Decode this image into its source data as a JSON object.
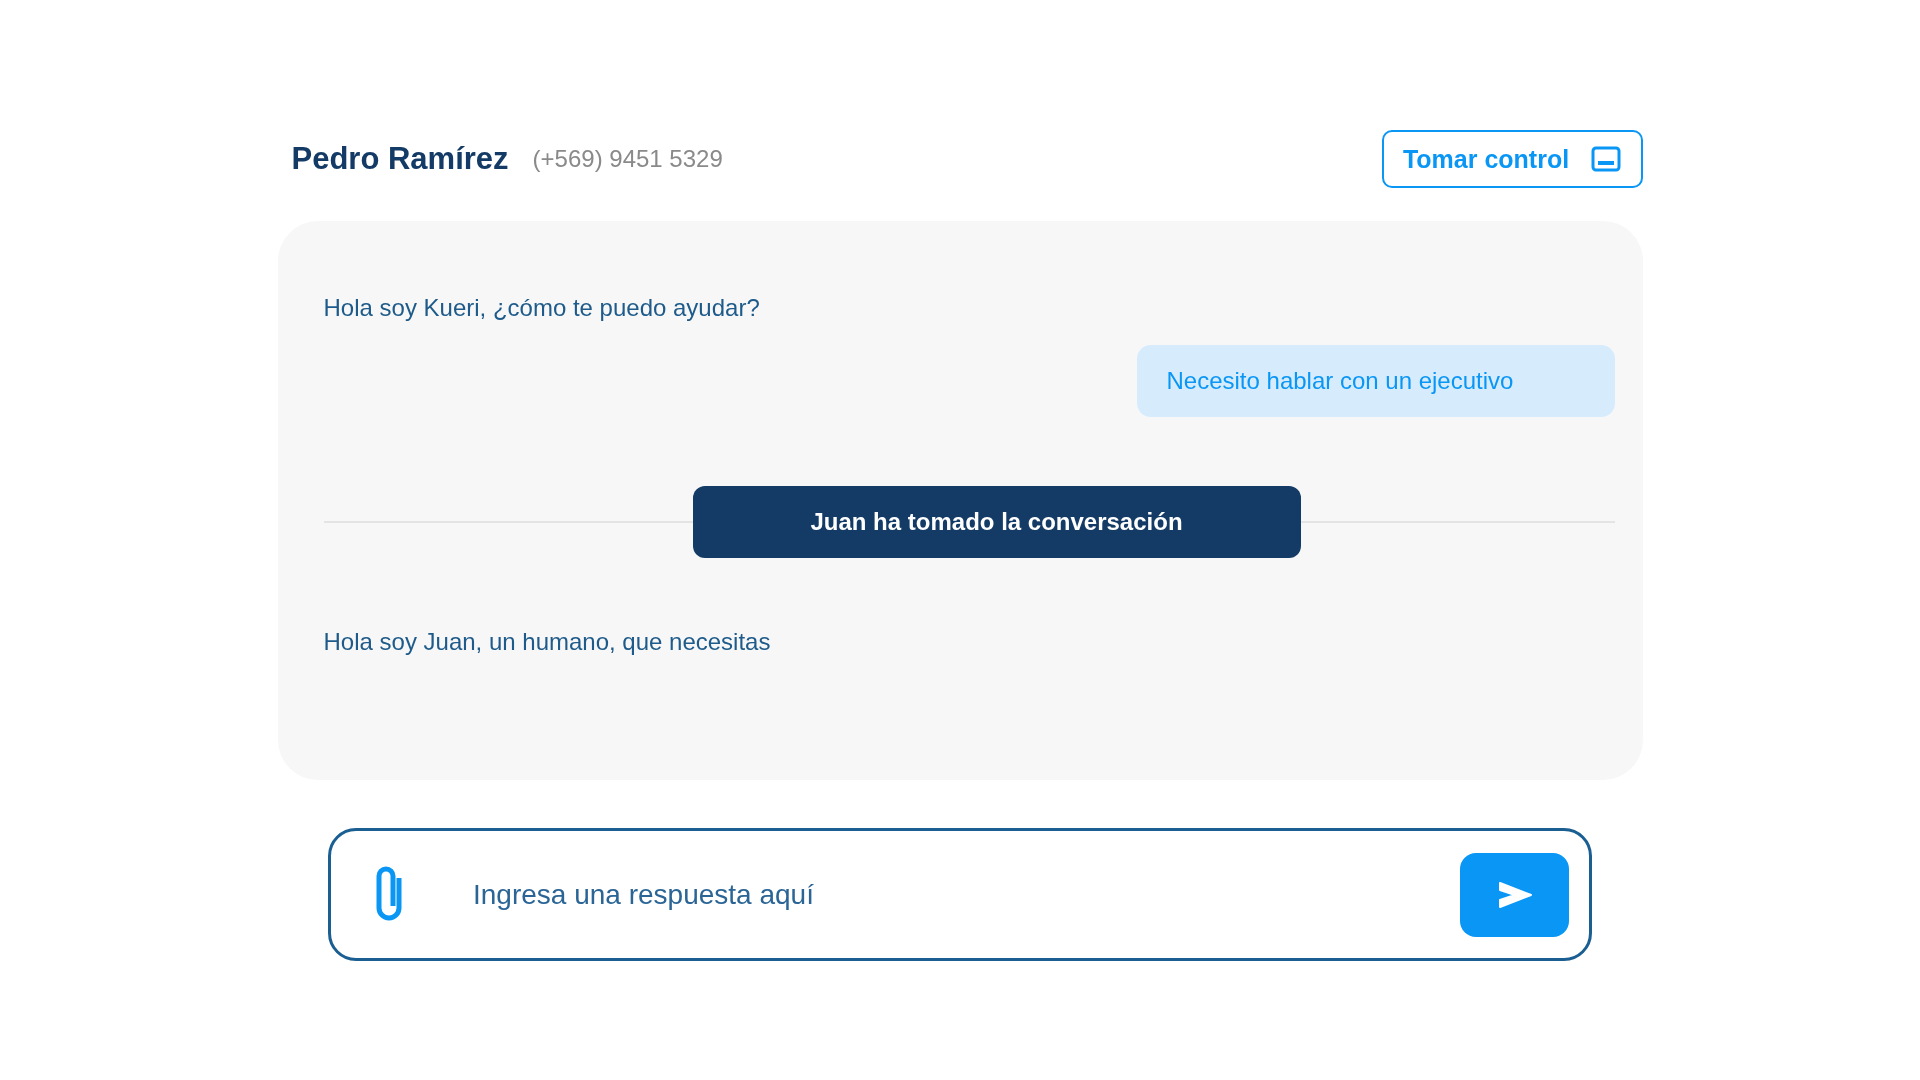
{
  "contact": {
    "name": "Pedro Ramírez",
    "phone": "(+569) 9451 5329"
  },
  "take_control_button": {
    "label": "Tomar control"
  },
  "messages": [
    {
      "kind": "bot",
      "text": "Hola soy Kueri, ¿cómo te puedo ayudar?"
    },
    {
      "kind": "user",
      "text": "Necesito hablar con un ejecutivo"
    },
    {
      "kind": "notice",
      "text": "Juan ha tomado la conversación"
    },
    {
      "kind": "bot",
      "text": "Hola soy Juan, un humano, que necesitas"
    }
  ],
  "composer": {
    "placeholder": "Ingresa una respuesta aquí"
  }
}
